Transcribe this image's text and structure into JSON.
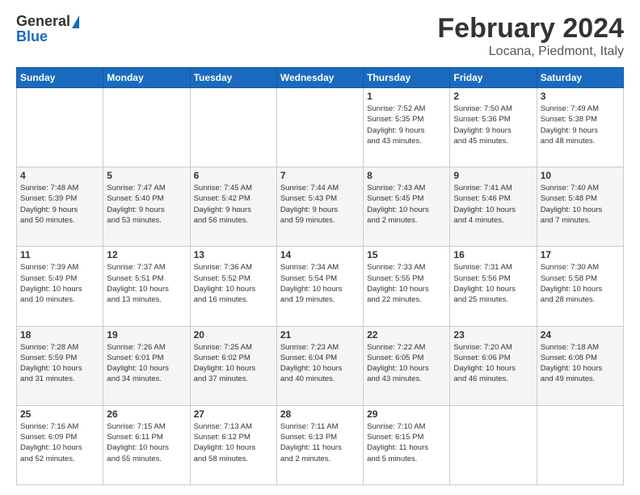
{
  "header": {
    "logo_general": "General",
    "logo_blue": "Blue",
    "month_title": "February 2024",
    "location": "Locana, Piedmont, Italy"
  },
  "days_of_week": [
    "Sunday",
    "Monday",
    "Tuesday",
    "Wednesday",
    "Thursday",
    "Friday",
    "Saturday"
  ],
  "weeks": [
    {
      "days": [
        {
          "num": "",
          "info": ""
        },
        {
          "num": "",
          "info": ""
        },
        {
          "num": "",
          "info": ""
        },
        {
          "num": "",
          "info": ""
        },
        {
          "num": "1",
          "info": "Sunrise: 7:52 AM\nSunset: 5:35 PM\nDaylight: 9 hours\nand 43 minutes."
        },
        {
          "num": "2",
          "info": "Sunrise: 7:50 AM\nSunset: 5:36 PM\nDaylight: 9 hours\nand 45 minutes."
        },
        {
          "num": "3",
          "info": "Sunrise: 7:49 AM\nSunset: 5:38 PM\nDaylight: 9 hours\nand 48 minutes."
        }
      ]
    },
    {
      "days": [
        {
          "num": "4",
          "info": "Sunrise: 7:48 AM\nSunset: 5:39 PM\nDaylight: 9 hours\nand 50 minutes."
        },
        {
          "num": "5",
          "info": "Sunrise: 7:47 AM\nSunset: 5:40 PM\nDaylight: 9 hours\nand 53 minutes."
        },
        {
          "num": "6",
          "info": "Sunrise: 7:45 AM\nSunset: 5:42 PM\nDaylight: 9 hours\nand 56 minutes."
        },
        {
          "num": "7",
          "info": "Sunrise: 7:44 AM\nSunset: 5:43 PM\nDaylight: 9 hours\nand 59 minutes."
        },
        {
          "num": "8",
          "info": "Sunrise: 7:43 AM\nSunset: 5:45 PM\nDaylight: 10 hours\nand 2 minutes."
        },
        {
          "num": "9",
          "info": "Sunrise: 7:41 AM\nSunset: 5:46 PM\nDaylight: 10 hours\nand 4 minutes."
        },
        {
          "num": "10",
          "info": "Sunrise: 7:40 AM\nSunset: 5:48 PM\nDaylight: 10 hours\nand 7 minutes."
        }
      ]
    },
    {
      "days": [
        {
          "num": "11",
          "info": "Sunrise: 7:39 AM\nSunset: 5:49 PM\nDaylight: 10 hours\nand 10 minutes."
        },
        {
          "num": "12",
          "info": "Sunrise: 7:37 AM\nSunset: 5:51 PM\nDaylight: 10 hours\nand 13 minutes."
        },
        {
          "num": "13",
          "info": "Sunrise: 7:36 AM\nSunset: 5:52 PM\nDaylight: 10 hours\nand 16 minutes."
        },
        {
          "num": "14",
          "info": "Sunrise: 7:34 AM\nSunset: 5:54 PM\nDaylight: 10 hours\nand 19 minutes."
        },
        {
          "num": "15",
          "info": "Sunrise: 7:33 AM\nSunset: 5:55 PM\nDaylight: 10 hours\nand 22 minutes."
        },
        {
          "num": "16",
          "info": "Sunrise: 7:31 AM\nSunset: 5:56 PM\nDaylight: 10 hours\nand 25 minutes."
        },
        {
          "num": "17",
          "info": "Sunrise: 7:30 AM\nSunset: 5:58 PM\nDaylight: 10 hours\nand 28 minutes."
        }
      ]
    },
    {
      "days": [
        {
          "num": "18",
          "info": "Sunrise: 7:28 AM\nSunset: 5:59 PM\nDaylight: 10 hours\nand 31 minutes."
        },
        {
          "num": "19",
          "info": "Sunrise: 7:26 AM\nSunset: 6:01 PM\nDaylight: 10 hours\nand 34 minutes."
        },
        {
          "num": "20",
          "info": "Sunrise: 7:25 AM\nSunset: 6:02 PM\nDaylight: 10 hours\nand 37 minutes."
        },
        {
          "num": "21",
          "info": "Sunrise: 7:23 AM\nSunset: 6:04 PM\nDaylight: 10 hours\nand 40 minutes."
        },
        {
          "num": "22",
          "info": "Sunrise: 7:22 AM\nSunset: 6:05 PM\nDaylight: 10 hours\nand 43 minutes."
        },
        {
          "num": "23",
          "info": "Sunrise: 7:20 AM\nSunset: 6:06 PM\nDaylight: 10 hours\nand 46 minutes."
        },
        {
          "num": "24",
          "info": "Sunrise: 7:18 AM\nSunset: 6:08 PM\nDaylight: 10 hours\nand 49 minutes."
        }
      ]
    },
    {
      "days": [
        {
          "num": "25",
          "info": "Sunrise: 7:16 AM\nSunset: 6:09 PM\nDaylight: 10 hours\nand 52 minutes."
        },
        {
          "num": "26",
          "info": "Sunrise: 7:15 AM\nSunset: 6:11 PM\nDaylight: 10 hours\nand 55 minutes."
        },
        {
          "num": "27",
          "info": "Sunrise: 7:13 AM\nSunset: 6:12 PM\nDaylight: 10 hours\nand 58 minutes."
        },
        {
          "num": "28",
          "info": "Sunrise: 7:11 AM\nSunset: 6:13 PM\nDaylight: 11 hours\nand 2 minutes."
        },
        {
          "num": "29",
          "info": "Sunrise: 7:10 AM\nSunset: 6:15 PM\nDaylight: 11 hours\nand 5 minutes."
        },
        {
          "num": "",
          "info": ""
        },
        {
          "num": "",
          "info": ""
        }
      ]
    }
  ]
}
